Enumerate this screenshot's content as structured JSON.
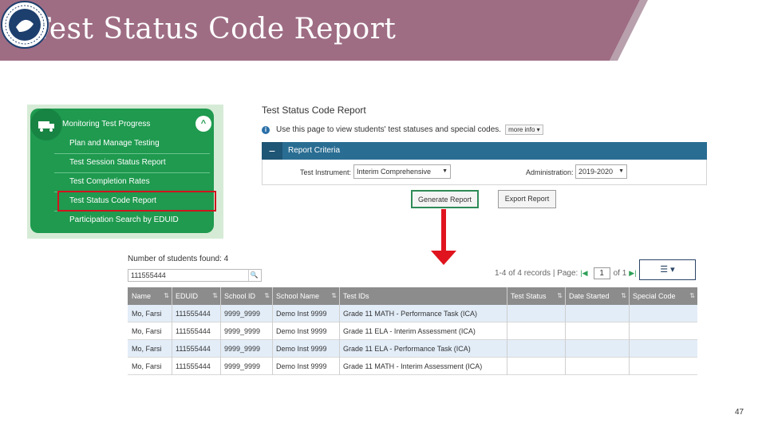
{
  "slide": {
    "title": "Test Status Code Report",
    "page_number": "47"
  },
  "menu": {
    "heading": "Monitoring Test Progress",
    "toggle": "^",
    "items": [
      {
        "label": "Plan and Manage Testing"
      },
      {
        "label": "Test Session Status Report"
      },
      {
        "label": "Test Completion Rates"
      },
      {
        "label": "Test Status Code Report",
        "highlighted": true
      },
      {
        "label": "Participation Search by EDUID"
      }
    ]
  },
  "report": {
    "title": "Test Status Code Report",
    "info_text": "Use this page to view students' test statuses and special codes.",
    "more_info": "more info ▾",
    "criteria_toggle": "−",
    "criteria_label": "Report Criteria",
    "test_instrument_label": "Test Instrument:",
    "test_instrument_value": "Interim Comprehensive",
    "administration_label": "Administration:",
    "administration_value": "2019-2020",
    "generate_button": "Generate Report",
    "export_button": "Export Report"
  },
  "results": {
    "count_text": "Number of students found: 4",
    "search_value": "111555444",
    "records_text": "1-4 of 4 records | Page:",
    "page_value": "1",
    "of_pages": "of 1",
    "columns_button": "☰ ▾",
    "columns": [
      "Name",
      "EDUID",
      "School ID",
      "School Name",
      "Test IDs",
      "Test Status",
      "Date Started",
      "Special Code"
    ],
    "rows": [
      [
        "Mo, Farsi",
        "111555444",
        "9999_9999",
        "Demo Inst 9999",
        "Grade 11 MATH - Performance Task (ICA)",
        "",
        "",
        ""
      ],
      [
        "Mo, Farsi",
        "111555444",
        "9999_9999",
        "Demo Inst 9999",
        "Grade 11 ELA - Interim Assessment (ICA)",
        "",
        "",
        ""
      ],
      [
        "Mo, Farsi",
        "111555444",
        "9999_9999",
        "Demo Inst 9999",
        "Grade 11 ELA - Performance Task (ICA)",
        "",
        "",
        ""
      ],
      [
        "Mo, Farsi",
        "111555444",
        "9999_9999",
        "Demo Inst 9999",
        "Grade 11 MATH - Interim Assessment (ICA)",
        "",
        "",
        ""
      ]
    ]
  },
  "colors": {
    "banner": "#9e6d84",
    "menu_green": "#1f9a4f",
    "criteria_blue": "#2a6d93",
    "highlight_red": "#d0141f",
    "arrow_red": "#e0141e"
  }
}
